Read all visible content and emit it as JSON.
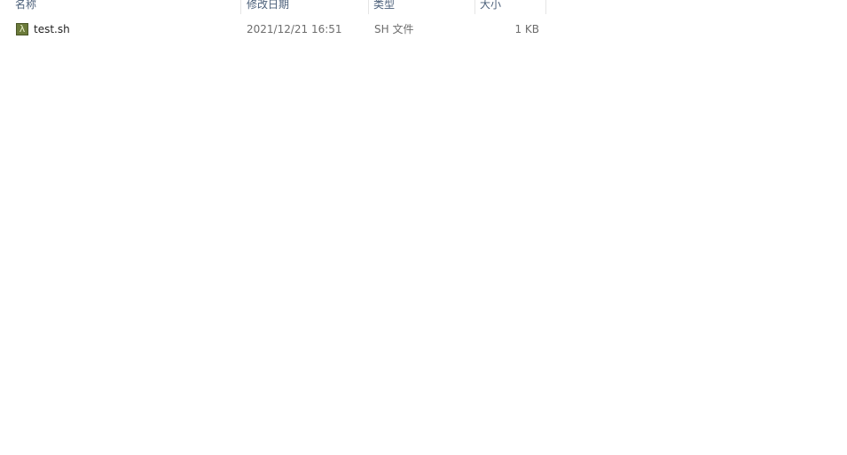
{
  "columns": {
    "name": "名称",
    "modified": "修改日期",
    "type": "类型",
    "size": "大小"
  },
  "files": [
    {
      "icon": "lambda-script-icon",
      "icon_glyph": "λ",
      "name": "test.sh",
      "modified": "2021/12/21 16:51",
      "type": "SH 文件",
      "size": "1 KB"
    }
  ]
}
